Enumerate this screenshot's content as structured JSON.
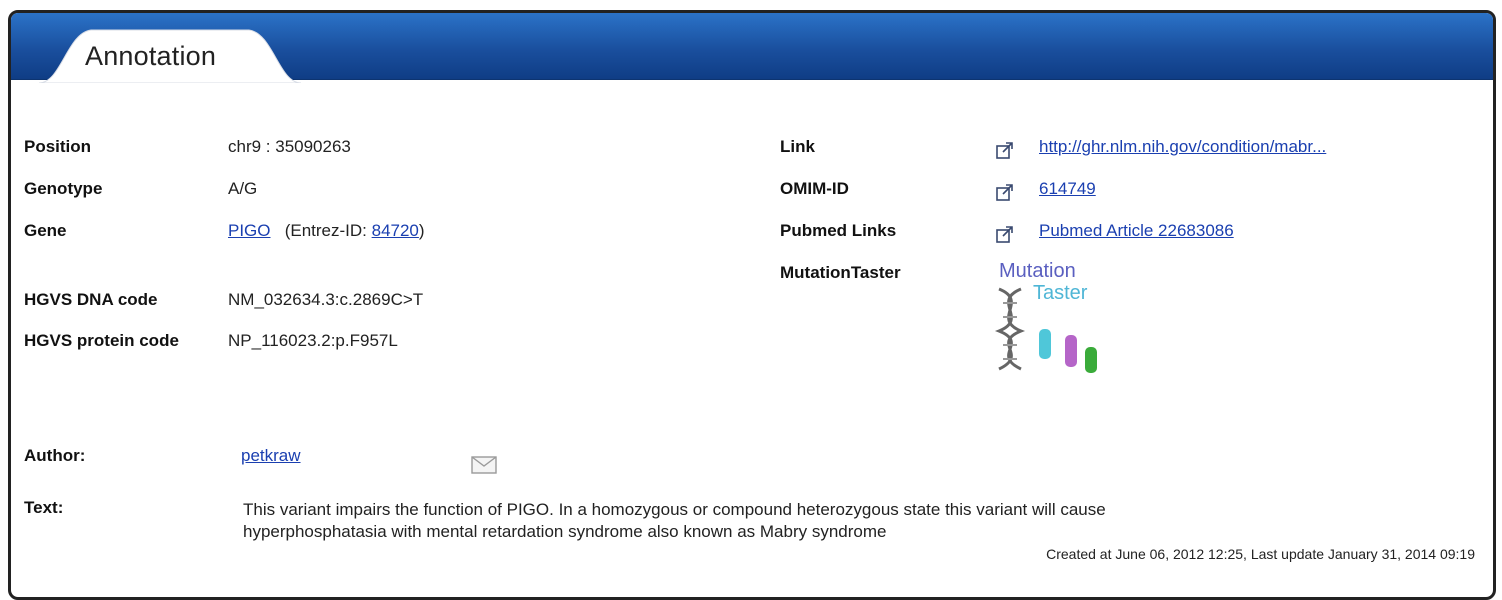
{
  "tab": {
    "label": "Annotation"
  },
  "left": {
    "position": {
      "label": "Position",
      "value": "chr9 : 35090263"
    },
    "genotype": {
      "label": "Genotype",
      "value": "A/G"
    },
    "gene": {
      "label": "Gene",
      "symbol": "PIGO",
      "entrez_prefix": "(Entrez-ID:",
      "entrez_id": "84720",
      "entrez_suffix": ")"
    },
    "hgvs_dna": {
      "label": "HGVS DNA code",
      "value": "NM_032634.3:c.2869C>T"
    },
    "hgvs_protein": {
      "label": "HGVS protein code",
      "value": "NP_116023.2:p.F957L"
    }
  },
  "right": {
    "link": {
      "label": "Link",
      "value": "http://ghr.nlm.nih.gov/condition/mabr..."
    },
    "omim": {
      "label": "OMIM-ID",
      "value": "614749"
    },
    "pubmed": {
      "label": "Pubmed Links",
      "value": "Pubmed Article 22683086"
    },
    "mutationtaster": {
      "label": "MutationTaster",
      "logo_top": "Mutation",
      "logo_bottom": "Taster"
    }
  },
  "author": {
    "label": "Author:",
    "value": "petkraw"
  },
  "text": {
    "label": "Text:",
    "line1": "This variant impairs the function of PIGO. In a homozygous or compound heterozygous state this variant will cause",
    "line2": "hyperphosphatasia with mental retardation syndrome also known as Mabry syndrome"
  },
  "meta": {
    "created": "Created at June 06, 2012 12:25, Last update January 31, 2014 09:19"
  },
  "icons": {
    "external": "external-link-icon",
    "mail": "mail-icon",
    "logo": "mutationtaster-logo"
  },
  "colors": {
    "header": "#1a4f9e",
    "link": "#1a3fb0",
    "tab": "#ffffff"
  }
}
